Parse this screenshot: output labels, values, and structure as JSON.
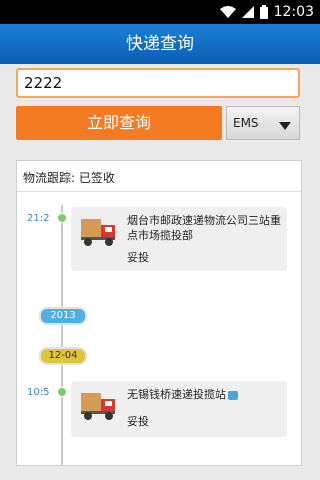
{
  "status_bar": {
    "time": "12:03"
  },
  "header": {
    "title": "快递查询"
  },
  "form": {
    "tracking_number": "2222",
    "query_button_label": "立即查询",
    "courier_selected": "EMS"
  },
  "tracking": {
    "status_label": "物流跟踪: 已签收",
    "events": [
      {
        "time": "21:2",
        "location": "烟台市邮政速递物流公司三站重点市场揽投部",
        "status": "妥投"
      },
      {
        "time": "10:5",
        "location": "无锡钱桥速递投揽站",
        "status": "妥投"
      }
    ],
    "year_marker": "2013",
    "date_marker": "12-04"
  },
  "colors": {
    "accent_orange": "#f57a24",
    "title_blue": "#0b5fb3",
    "timeline_dot": "#7ccd6a"
  }
}
